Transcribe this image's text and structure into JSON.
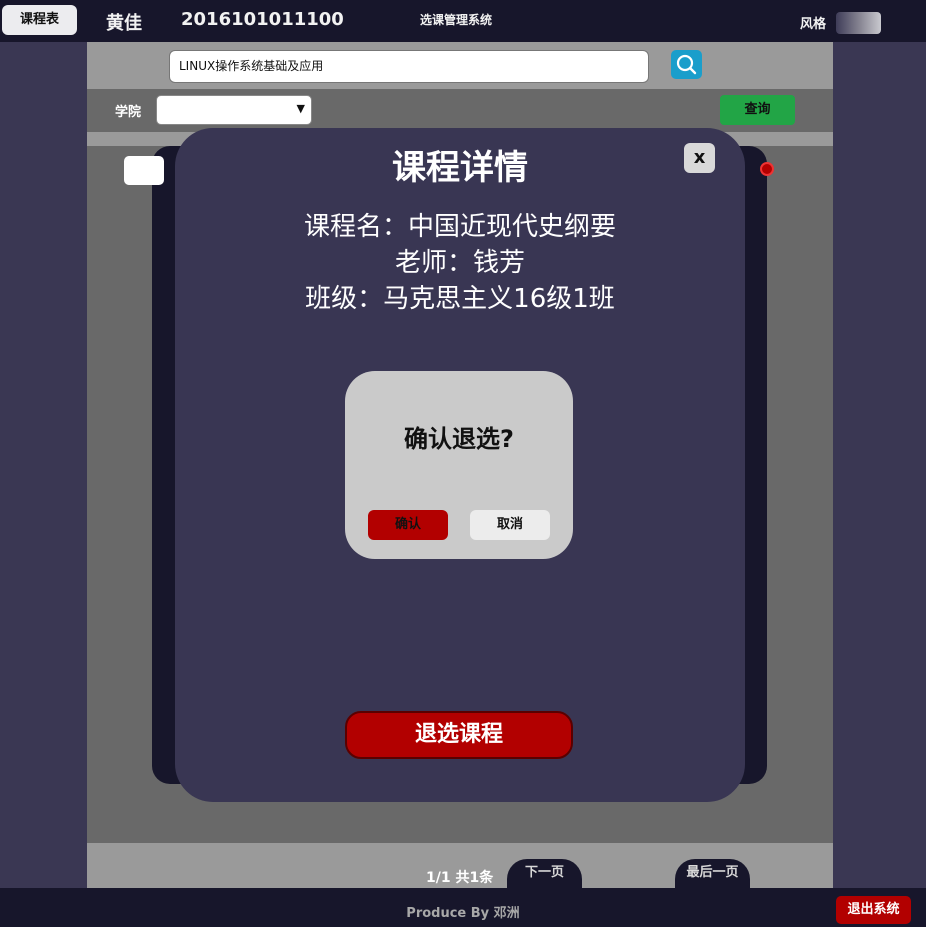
{
  "topbar": {
    "schedule_button": "课程表",
    "student_name": "黄佳",
    "student_id": "2016101011100",
    "system_title": "选课管理系统",
    "style_label": "风格"
  },
  "search": {
    "value": "LINUX操作系统基础及应用",
    "icon": "search-icon"
  },
  "filter": {
    "college_label": "学院",
    "college_selected": "",
    "query_button": "查询"
  },
  "modal": {
    "title": "课程详情",
    "close_label": "x",
    "course_line": "课程名：中国近现代史纲要",
    "teacher_line": "老师：钱芳",
    "class_line": "班级：马克思主义16级1班",
    "confirm_question": "确认退选?",
    "confirm_ok": "确认",
    "confirm_cancel": "取消",
    "drop_button": "退选课程"
  },
  "pagination": {
    "info": "1/1 共1条",
    "next": "下一页",
    "last": "最后一页"
  },
  "footer": {
    "credit": "Produce By 邓洲",
    "exit_button": "退出系统"
  },
  "colors": {
    "accent_red": "#b20000",
    "accent_green": "#22a546",
    "accent_blue": "#1a9ecb",
    "dark_bg": "#17162b",
    "modal_bg": "#393653"
  }
}
